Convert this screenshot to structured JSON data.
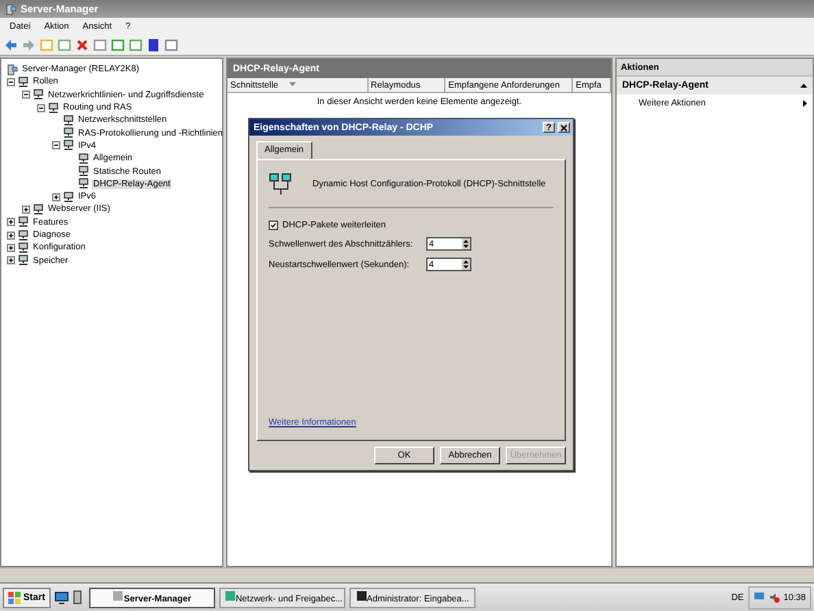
{
  "window": {
    "title": "Server-Manager"
  },
  "menu": [
    "Datei",
    "Aktion",
    "Ansicht",
    "?"
  ],
  "tree": [
    {
      "label": "Server-Manager (RELAY2K8)",
      "selected": false,
      "children": [
        {
          "label": "Rollen",
          "selected": false,
          "expanded": true,
          "children": [
            {
              "label": "Netzwerkrichtlinien- und Zugriffsdienste",
              "selected": false,
              "expanded": true,
              "children": [
                {
                  "label": "Routing und RAS",
                  "selected": false,
                  "expanded": true,
                  "children": [
                    {
                      "label": "Netzwerkschnittstellen",
                      "selected": false
                    },
                    {
                      "label": "RAS-Protokollierung und -Richtlinien",
                      "selected": false
                    },
                    {
                      "label": "IPv4",
                      "selected": false,
                      "expanded": true,
                      "children": [
                        {
                          "label": "Allgemein",
                          "selected": false
                        },
                        {
                          "label": "Statische Routen",
                          "selected": false
                        },
                        {
                          "label": "DHCP-Relay-Agent",
                          "selected": true
                        }
                      ]
                    },
                    {
                      "label": "IPv6",
                      "selected": false,
                      "expanded": false
                    }
                  ]
                }
              ]
            },
            {
              "label": "Webserver (IIS)",
              "selected": false,
              "expanded": false
            }
          ]
        },
        {
          "label": "Features",
          "selected": false,
          "expanded": false
        },
        {
          "label": "Diagnose",
          "selected": false,
          "expanded": false
        },
        {
          "label": "Konfiguration",
          "selected": false,
          "expanded": false
        },
        {
          "label": "Speicher",
          "selected": false,
          "expanded": false
        }
      ]
    }
  ],
  "center": {
    "title": "DHCP-Relay-Agent",
    "columns": [
      {
        "label": "Schnittstelle",
        "sorted": true
      },
      {
        "label": "Relaymodus",
        "sorted": false
      },
      {
        "label": "Empfangene Anforderungen",
        "sorted": false
      },
      {
        "label": "Empfa",
        "sorted": false
      }
    ],
    "empty_message": "In dieser Ansicht werden keine Elemente angezeigt."
  },
  "actions": {
    "title": "Aktionen",
    "section": "DHCP-Relay-Agent",
    "items": [
      "Weitere Aktionen"
    ]
  },
  "dialog": {
    "title": "Eigenschaften von DHCP-Relay - DCHP",
    "help_button": "?",
    "tabs": [
      {
        "label": "Allgemein",
        "selected": true
      }
    ],
    "description": "Dynamic Host Configuration-Protokoll (DHCP)-Schnittstelle",
    "checkbox": {
      "label": "DHCP-Pakete weiterleiten",
      "checked": true
    },
    "fields": [
      {
        "label": "Schwellenwert des Abschnittzählers:",
        "value": "4"
      },
      {
        "label": "Neustartschwellenwert (Sekunden):",
        "value": "4"
      }
    ],
    "link": "Weitere Informationen",
    "buttons": [
      {
        "label": "OK",
        "disabled": false
      },
      {
        "label": "Abbrechen",
        "disabled": false
      },
      {
        "label": "Übernehmen",
        "disabled": true
      }
    ]
  },
  "taskbar": {
    "start": "Start",
    "tasks": [
      {
        "label": "Server-Manager",
        "selected": true
      },
      {
        "label": "Netzwerk- und Freigabec...",
        "selected": false
      },
      {
        "label": "Administrator: Eingabea...",
        "selected": false
      }
    ],
    "language": "DE",
    "clock": "10:38"
  }
}
